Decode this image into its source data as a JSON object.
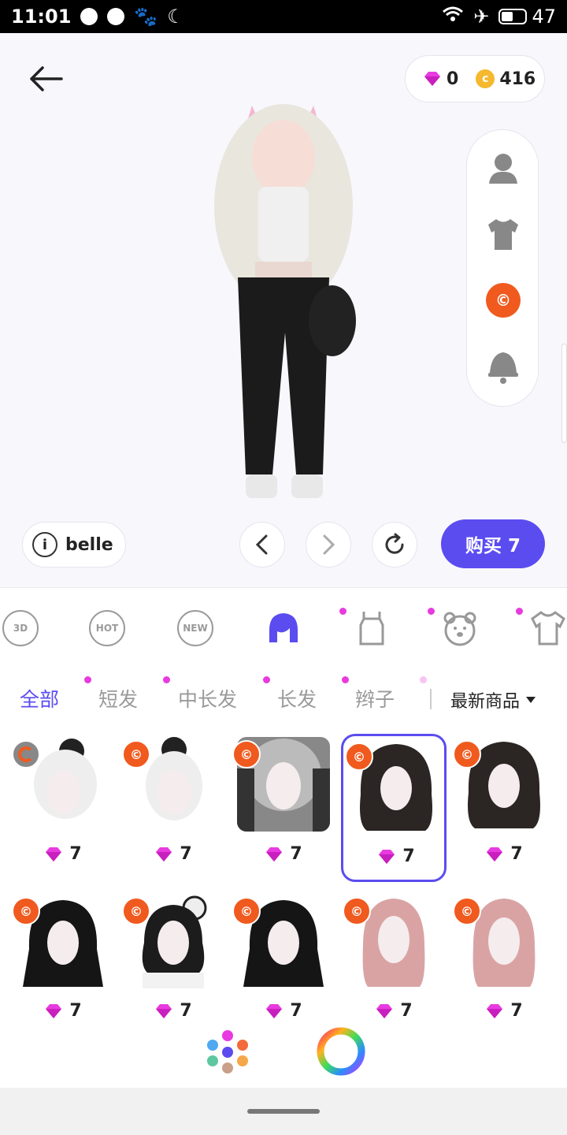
{
  "status_bar": {
    "time": "11:01",
    "battery": "47"
  },
  "currency": {
    "gems": "0",
    "coins": "416"
  },
  "user": {
    "name": "belle"
  },
  "buy_button": {
    "label": "购买 7"
  },
  "subtabs": [
    "全部",
    "短发",
    "中长发",
    "长发",
    "辫子"
  ],
  "sort": {
    "label": "最新商品"
  },
  "categories": [
    "3D",
    "HOT",
    "NEW"
  ],
  "items": [
    {
      "price": "7"
    },
    {
      "price": "7"
    },
    {
      "price": "7"
    },
    {
      "price": "7"
    },
    {
      "price": "7"
    },
    {
      "price": "7"
    },
    {
      "price": "7"
    },
    {
      "price": "7"
    },
    {
      "price": "7"
    },
    {
      "price": "7"
    }
  ],
  "colors": {
    "accent": "#5b4cf0",
    "badge": "#f05a1e",
    "gem": "#e83ae0",
    "coin": "#f5b82e"
  }
}
